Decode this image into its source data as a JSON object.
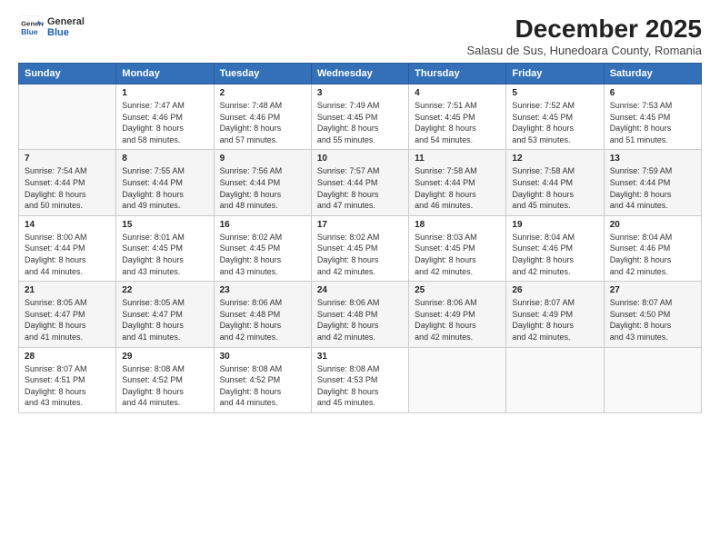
{
  "logo": {
    "line1": "General",
    "line2": "Blue"
  },
  "title": "December 2025",
  "subtitle": "Salasu de Sus, Hunedoara County, Romania",
  "days_header": [
    "Sunday",
    "Monday",
    "Tuesday",
    "Wednesday",
    "Thursday",
    "Friday",
    "Saturday"
  ],
  "weeks": [
    [
      {
        "num": "",
        "info": ""
      },
      {
        "num": "1",
        "info": "Sunrise: 7:47 AM\nSunset: 4:46 PM\nDaylight: 8 hours\nand 58 minutes."
      },
      {
        "num": "2",
        "info": "Sunrise: 7:48 AM\nSunset: 4:46 PM\nDaylight: 8 hours\nand 57 minutes."
      },
      {
        "num": "3",
        "info": "Sunrise: 7:49 AM\nSunset: 4:45 PM\nDaylight: 8 hours\nand 55 minutes."
      },
      {
        "num": "4",
        "info": "Sunrise: 7:51 AM\nSunset: 4:45 PM\nDaylight: 8 hours\nand 54 minutes."
      },
      {
        "num": "5",
        "info": "Sunrise: 7:52 AM\nSunset: 4:45 PM\nDaylight: 8 hours\nand 53 minutes."
      },
      {
        "num": "6",
        "info": "Sunrise: 7:53 AM\nSunset: 4:45 PM\nDaylight: 8 hours\nand 51 minutes."
      }
    ],
    [
      {
        "num": "7",
        "info": "Sunrise: 7:54 AM\nSunset: 4:44 PM\nDaylight: 8 hours\nand 50 minutes."
      },
      {
        "num": "8",
        "info": "Sunrise: 7:55 AM\nSunset: 4:44 PM\nDaylight: 8 hours\nand 49 minutes."
      },
      {
        "num": "9",
        "info": "Sunrise: 7:56 AM\nSunset: 4:44 PM\nDaylight: 8 hours\nand 48 minutes."
      },
      {
        "num": "10",
        "info": "Sunrise: 7:57 AM\nSunset: 4:44 PM\nDaylight: 8 hours\nand 47 minutes."
      },
      {
        "num": "11",
        "info": "Sunrise: 7:58 AM\nSunset: 4:44 PM\nDaylight: 8 hours\nand 46 minutes."
      },
      {
        "num": "12",
        "info": "Sunrise: 7:58 AM\nSunset: 4:44 PM\nDaylight: 8 hours\nand 45 minutes."
      },
      {
        "num": "13",
        "info": "Sunrise: 7:59 AM\nSunset: 4:44 PM\nDaylight: 8 hours\nand 44 minutes."
      }
    ],
    [
      {
        "num": "14",
        "info": "Sunrise: 8:00 AM\nSunset: 4:44 PM\nDaylight: 8 hours\nand 44 minutes."
      },
      {
        "num": "15",
        "info": "Sunrise: 8:01 AM\nSunset: 4:45 PM\nDaylight: 8 hours\nand 43 minutes."
      },
      {
        "num": "16",
        "info": "Sunrise: 8:02 AM\nSunset: 4:45 PM\nDaylight: 8 hours\nand 43 minutes."
      },
      {
        "num": "17",
        "info": "Sunrise: 8:02 AM\nSunset: 4:45 PM\nDaylight: 8 hours\nand 42 minutes."
      },
      {
        "num": "18",
        "info": "Sunrise: 8:03 AM\nSunset: 4:45 PM\nDaylight: 8 hours\nand 42 minutes."
      },
      {
        "num": "19",
        "info": "Sunrise: 8:04 AM\nSunset: 4:46 PM\nDaylight: 8 hours\nand 42 minutes."
      },
      {
        "num": "20",
        "info": "Sunrise: 8:04 AM\nSunset: 4:46 PM\nDaylight: 8 hours\nand 42 minutes."
      }
    ],
    [
      {
        "num": "21",
        "info": "Sunrise: 8:05 AM\nSunset: 4:47 PM\nDaylight: 8 hours\nand 41 minutes."
      },
      {
        "num": "22",
        "info": "Sunrise: 8:05 AM\nSunset: 4:47 PM\nDaylight: 8 hours\nand 41 minutes."
      },
      {
        "num": "23",
        "info": "Sunrise: 8:06 AM\nSunset: 4:48 PM\nDaylight: 8 hours\nand 42 minutes."
      },
      {
        "num": "24",
        "info": "Sunrise: 8:06 AM\nSunset: 4:48 PM\nDaylight: 8 hours\nand 42 minutes."
      },
      {
        "num": "25",
        "info": "Sunrise: 8:06 AM\nSunset: 4:49 PM\nDaylight: 8 hours\nand 42 minutes."
      },
      {
        "num": "26",
        "info": "Sunrise: 8:07 AM\nSunset: 4:49 PM\nDaylight: 8 hours\nand 42 minutes."
      },
      {
        "num": "27",
        "info": "Sunrise: 8:07 AM\nSunset: 4:50 PM\nDaylight: 8 hours\nand 43 minutes."
      }
    ],
    [
      {
        "num": "28",
        "info": "Sunrise: 8:07 AM\nSunset: 4:51 PM\nDaylight: 8 hours\nand 43 minutes."
      },
      {
        "num": "29",
        "info": "Sunrise: 8:08 AM\nSunset: 4:52 PM\nDaylight: 8 hours\nand 44 minutes."
      },
      {
        "num": "30",
        "info": "Sunrise: 8:08 AM\nSunset: 4:52 PM\nDaylight: 8 hours\nand 44 minutes."
      },
      {
        "num": "31",
        "info": "Sunrise: 8:08 AM\nSunset: 4:53 PM\nDaylight: 8 hours\nand 45 minutes."
      },
      {
        "num": "",
        "info": ""
      },
      {
        "num": "",
        "info": ""
      },
      {
        "num": "",
        "info": ""
      }
    ]
  ]
}
